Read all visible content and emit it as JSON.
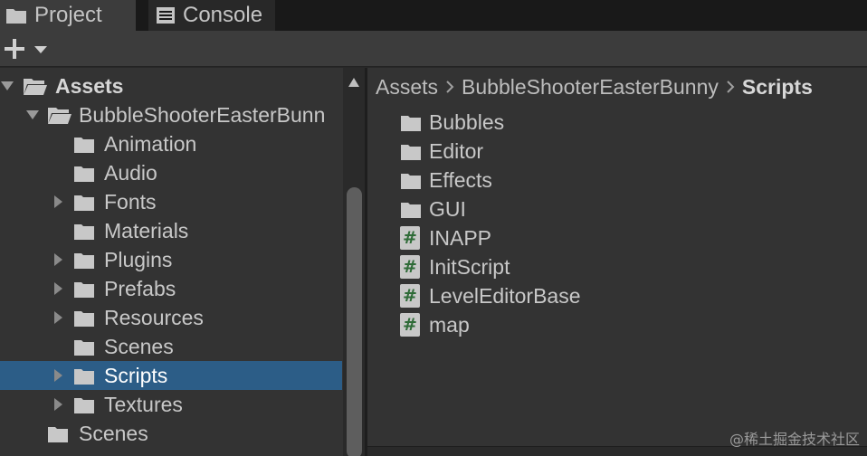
{
  "tabs": [
    {
      "label": "Project",
      "icon": "folder-icon"
    },
    {
      "label": "Console",
      "icon": "console-icon"
    }
  ],
  "toolbar": {
    "add_icon": "plus-icon",
    "dropdown_icon": "caret-down-icon"
  },
  "tree": {
    "items": [
      {
        "label": "Assets",
        "depth": 0,
        "arrow": "expanded",
        "icon": "folder-open-icon",
        "bold": true
      },
      {
        "label": "BubbleShooterEasterBunn",
        "depth": 1,
        "arrow": "expanded",
        "icon": "folder-open-icon"
      },
      {
        "label": "Animation",
        "depth": 2,
        "arrow": "none",
        "icon": "folder-icon"
      },
      {
        "label": "Audio",
        "depth": 2,
        "arrow": "none",
        "icon": "folder-icon"
      },
      {
        "label": "Fonts",
        "depth": 2,
        "arrow": "collapsed",
        "icon": "folder-icon"
      },
      {
        "label": "Materials",
        "depth": 2,
        "arrow": "none",
        "icon": "folder-icon"
      },
      {
        "label": "Plugins",
        "depth": 2,
        "arrow": "collapsed",
        "icon": "folder-icon"
      },
      {
        "label": "Prefabs",
        "depth": 2,
        "arrow": "collapsed",
        "icon": "folder-icon"
      },
      {
        "label": "Resources",
        "depth": 2,
        "arrow": "collapsed",
        "icon": "folder-icon"
      },
      {
        "label": "Scenes",
        "depth": 2,
        "arrow": "none",
        "icon": "folder-icon"
      },
      {
        "label": "Scripts",
        "depth": 2,
        "arrow": "collapsed",
        "icon": "folder-icon",
        "selected": true
      },
      {
        "label": "Textures",
        "depth": 2,
        "arrow": "collapsed",
        "icon": "folder-icon"
      },
      {
        "label": "Scenes",
        "depth": 1,
        "arrow": "none",
        "icon": "folder-icon"
      }
    ]
  },
  "breadcrumb": [
    "Assets",
    "BubbleShooterEasterBunny",
    "Scripts"
  ],
  "files": [
    {
      "label": "Bubbles",
      "type": "folder"
    },
    {
      "label": "Editor",
      "type": "folder"
    },
    {
      "label": "Effects",
      "type": "folder"
    },
    {
      "label": "GUI",
      "type": "folder"
    },
    {
      "label": "INAPP",
      "type": "script"
    },
    {
      "label": "InitScript",
      "type": "script"
    },
    {
      "label": "LevelEditorBase",
      "type": "script"
    },
    {
      "label": "map",
      "type": "script"
    }
  ],
  "script_glyph": "#",
  "watermark": "@稀土掘金技术社区",
  "colors": {
    "selection": "#2c5d87",
    "panel": "#333333",
    "tab_active": "#3c3c3c",
    "script_hash": "#2e6b37"
  }
}
